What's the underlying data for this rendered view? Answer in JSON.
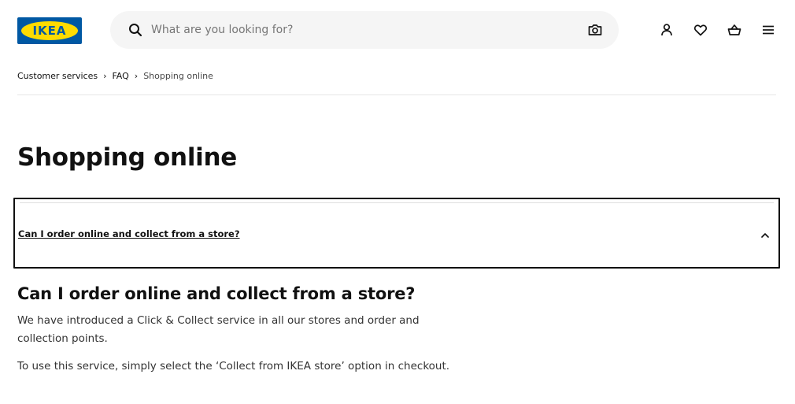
{
  "header": {
    "logo_text": "IKEA",
    "search_placeholder": "What are you looking for?",
    "icons": [
      "search-icon",
      "camera-icon",
      "profile-icon",
      "heart-icon",
      "basket-icon",
      "menu-icon"
    ]
  },
  "breadcrumb": {
    "items": [
      "Customer services",
      "FAQ"
    ],
    "current": "Shopping online",
    "separator": "›"
  },
  "page_title": "Shopping online",
  "accordion": {
    "title": "Can I order online and collect from a store?",
    "expanded": true
  },
  "answer": {
    "heading": "Can I order online and collect from a store?",
    "paragraphs": [
      "We have introduced a Click & Collect service in all our stores and order and collection points.",
      "To use this service, simply select the ‘Collect from IKEA store’ option in checkout."
    ]
  },
  "colors": {
    "brand_blue": "#0058A3",
    "brand_yellow": "#FFDB00",
    "search_bg": "#f5f5f5",
    "text": "#111111"
  }
}
